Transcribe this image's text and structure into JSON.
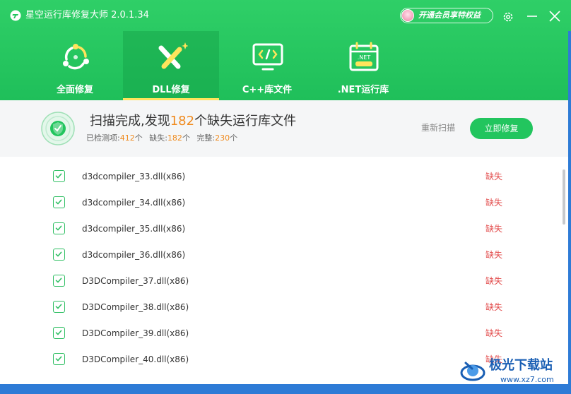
{
  "window": {
    "title": "星空运行库修复大师 2.0.1.34",
    "vip_label": "开通会员享特权益"
  },
  "tabs": [
    {
      "label": "全面修复",
      "active": false
    },
    {
      "label": "DLL修复",
      "active": true
    },
    {
      "label": "C++库文件",
      "active": false
    },
    {
      "label": ".NET运行库",
      "active": false
    }
  ],
  "icons": {
    "net_badge": ".NET"
  },
  "summary": {
    "headline_prefix": "扫描完成,发现",
    "missing_count": "182",
    "headline_suffix": "个缺失运行库文件",
    "detected_label": "已检测项:",
    "detected_count": "412",
    "unit": "个",
    "missing_label": "缺失:",
    "complete_label": "完整:",
    "complete_count": "230",
    "rescan_label": "重新扫描",
    "fix_label": "立即修复"
  },
  "files": [
    {
      "name": "d3dcompiler_33.dll(x86)",
      "status": "缺失",
      "checked": true
    },
    {
      "name": "d3dcompiler_34.dll(x86)",
      "status": "缺失",
      "checked": true
    },
    {
      "name": "d3dcompiler_35.dll(x86)",
      "status": "缺失",
      "checked": true
    },
    {
      "name": "d3dcompiler_36.dll(x86)",
      "status": "缺失",
      "checked": true
    },
    {
      "name": "D3DCompiler_37.dll(x86)",
      "status": "缺失",
      "checked": true
    },
    {
      "name": "D3DCompiler_38.dll(x86)",
      "status": "缺失",
      "checked": true
    },
    {
      "name": "D3DCompiler_39.dll(x86)",
      "status": "缺失",
      "checked": true
    },
    {
      "name": "D3DCompiler_40.dll(x86)",
      "status": "缺失",
      "checked": true
    }
  ],
  "watermark": {
    "title": "极光下载站",
    "url": "www.xz7.com"
  },
  "colors": {
    "brand_green": "#22c55e",
    "accent_orange": "#f08a1d",
    "missing_red": "#e24b4b"
  }
}
